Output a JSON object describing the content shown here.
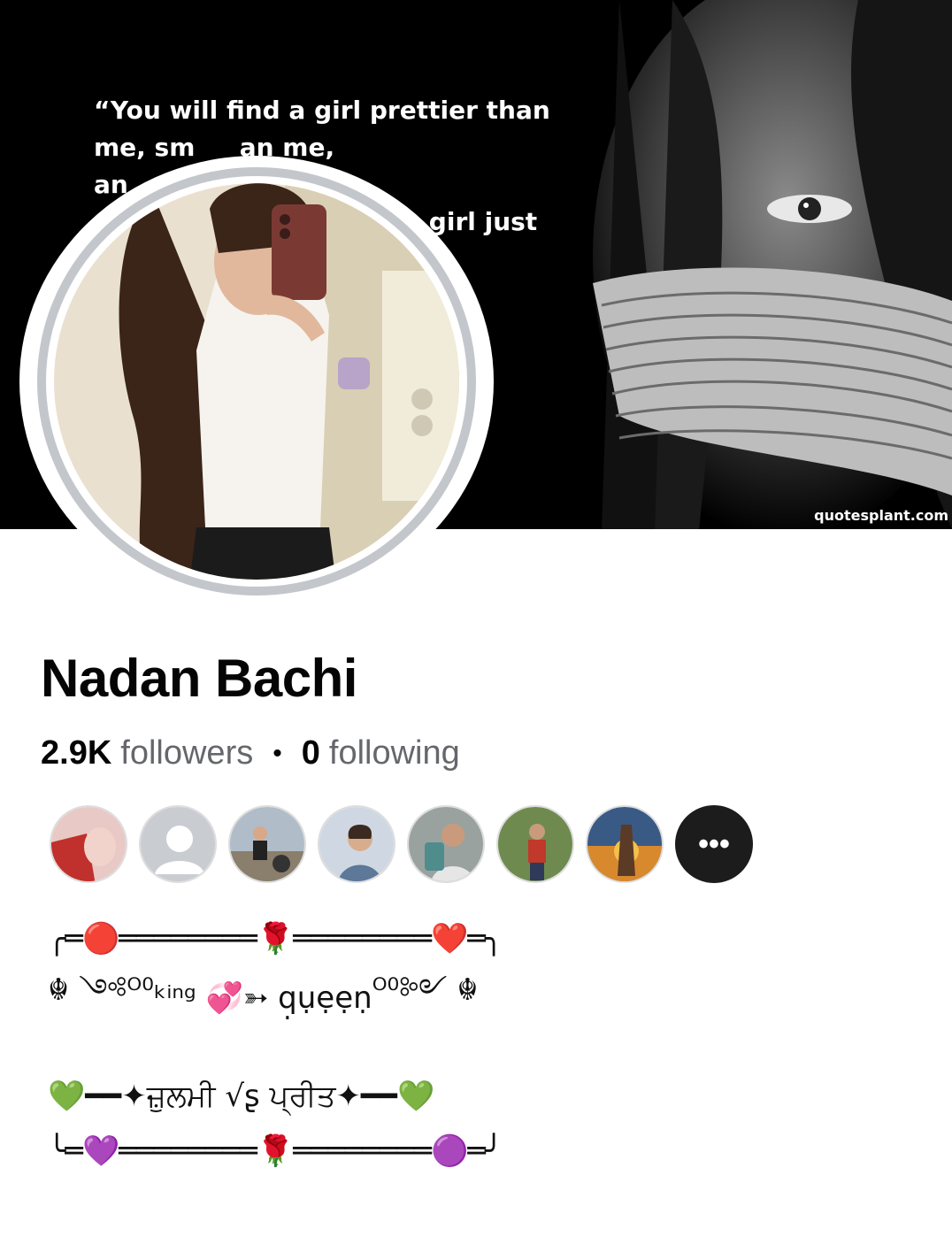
{
  "cover": {
    "quote": "“You will find a girl prettier than\nme, sm         an me,\nan\n                                                                   girl just",
    "watermark": "quotesplant.com"
  },
  "profile": {
    "name": "Nadan Bachi",
    "followers_count": "2.9K",
    "followers_label": "followers",
    "separator": "•",
    "following_count": "0",
    "following_label": "following"
  },
  "friends": {
    "more_label": "•••",
    "avatar_colors": [
      "#c0302c",
      "#c9ccd1",
      "#7a8aa0",
      "#a9b7c8",
      "#7b8c92",
      "#8aa36a",
      "#c88a3a"
    ]
  },
  "bio": {
    "line1": "╭═🔴════════🌹════════❤️═╮",
    "line2_left": "☬ ༺ᴼ⁰",
    "line2_mid": " ᵏⁱⁿᵍ 💞➳ q̣ụẹẹṇ ",
    "line2_right": "ᴼ⁰༻ ☬",
    "line3": "💚━━✦ਜ਼ੁਲਮੀ √ʂ ਪ੍ਰੀਤ✦━━💚",
    "line4": "╰═💜════════🌹════════🟣═╯"
  }
}
